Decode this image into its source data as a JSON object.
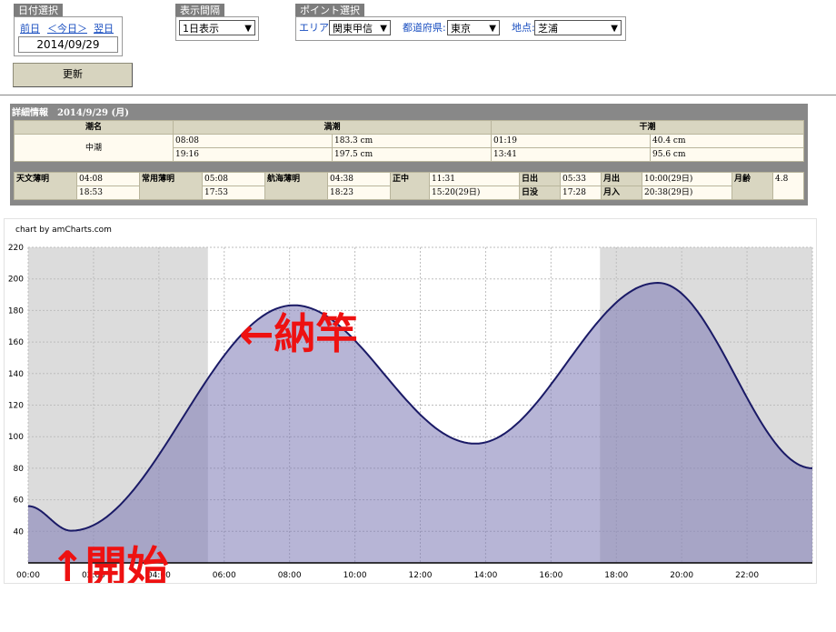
{
  "date_select": {
    "title": "日付選択",
    "prev": "前日",
    "today": "＜今日＞",
    "next": "翌日",
    "date": "2014/09/29"
  },
  "interval": {
    "title": "表示間隔",
    "value": "1日表示"
  },
  "point": {
    "title": "ポイント選択",
    "area_label": "エリア:",
    "area_value": "関東甲信",
    "pref_label": "都道府県:",
    "pref_value": "東京",
    "place_label": "地点:",
    "place_value": "芝浦"
  },
  "update_button": "更新",
  "details": {
    "title": "詳細情報　2014/9/29 (月)",
    "tide_name_header": "潮名",
    "high_header": "満潮",
    "low_header": "干潮",
    "tide_name": "中潮",
    "high": [
      {
        "time": "08:08",
        "level": "183.3 cm"
      },
      {
        "time": "19:16",
        "level": "197.5 cm"
      }
    ],
    "low": [
      {
        "time": "01:19",
        "level": "40.4 cm"
      },
      {
        "time": "13:41",
        "level": "95.6 cm"
      }
    ],
    "astro": {
      "astronomical_twilight_label": "天文薄明",
      "astronomical_twilight": [
        "04:08",
        "18:53"
      ],
      "civil_twilight_label": "常用薄明",
      "civil_twilight": [
        "05:08",
        "17:53"
      ],
      "nautical_twilight_label": "航海薄明",
      "nautical_twilight": [
        "04:38",
        "18:23"
      ],
      "noon_label": "正中",
      "noon": [
        "11:31",
        "15:20(29日)"
      ],
      "sunrise_label": "日出",
      "sunrise": "05:33",
      "sunset_label": "日没",
      "sunset": "17:28",
      "moonrise_label": "月出",
      "moonrise": "10:00(29日)",
      "moonset_label": "月入",
      "moonset": "20:38(29日)",
      "moon_age_label": "月齢",
      "moon_age": "4.8"
    }
  },
  "chart_credit": "chart by amCharts.com",
  "annotations": {
    "end": "←納竿",
    "start": "↑開始",
    "color": "#ee1111"
  },
  "chart_data": {
    "type": "area",
    "x_ticks": [
      "00:00",
      "02:00",
      "04:00",
      "06:00",
      "08:00",
      "10:00",
      "12:00",
      "14:00",
      "16:00",
      "18:00",
      "20:00",
      "22:00"
    ],
    "y_ticks": [
      40,
      60,
      80,
      100,
      120,
      140,
      160,
      180,
      200,
      220
    ],
    "ylim": [
      20,
      220
    ],
    "xlim_hours": [
      0,
      24
    ],
    "grid": true,
    "night_bands_hours": [
      [
        0,
        5.5
      ],
      [
        17.5,
        24
      ]
    ],
    "series": [
      {
        "x_hours": [
          0,
          1.32,
          8.13,
          13.68,
          19.27,
          24
        ],
        "values": [
          56,
          40.4,
          183.3,
          95.6,
          197.5,
          80
        ],
        "line_color": "#1a1a66",
        "fill_color": "#7b78b4"
      }
    ]
  }
}
